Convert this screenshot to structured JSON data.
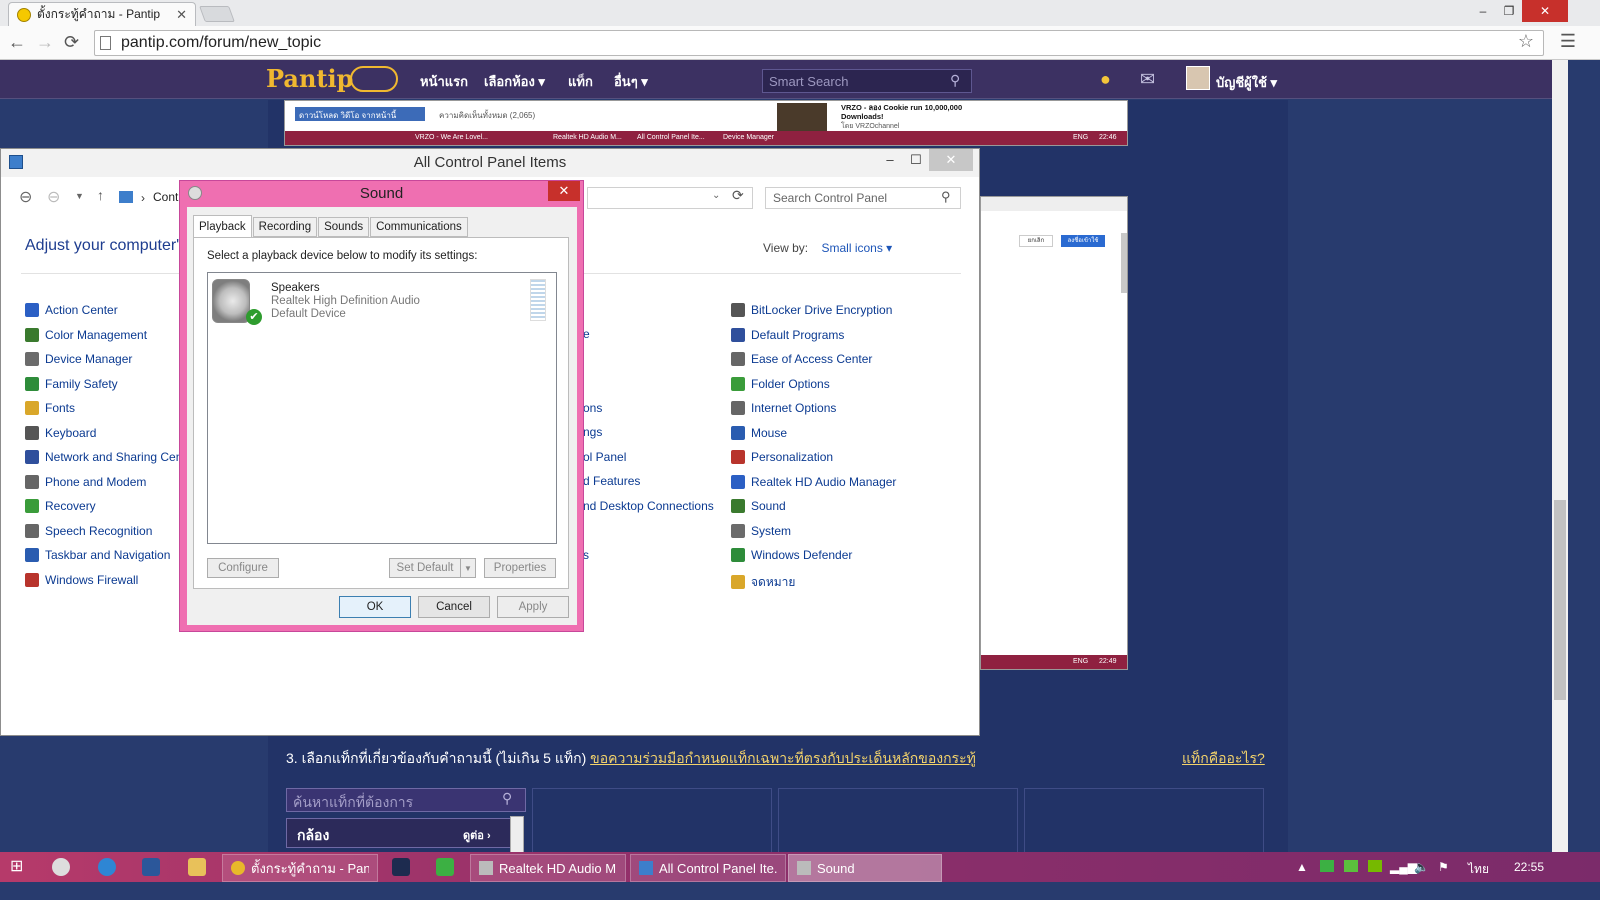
{
  "browser": {
    "tab_title": "ตั้งกระทู้คำถาม - Pantip",
    "url": "pantip.com/forum/new_topic"
  },
  "pantip": {
    "logo": "Pantip",
    "nav": [
      "หน้าแรก",
      "เลือกห้อง ▾",
      "แท็ก",
      "อื่นๆ ▾"
    ],
    "search_placeholder": "Smart Search",
    "user_label": "บัญชีผู้ใช้ ▾",
    "section3_text": "3. เลือกแท็กที่เกี่ยวข้องกับคำถามนี้ (ไม่เกิน 5 แท็ก)",
    "section3_link": "ขอความร่วมมือกำหนดแท็กเฉพาะที่ตรงกับประเด็นหลักของกระทู้",
    "tag_help": "แท็กคืออะไร?",
    "tag_search_placeholder": "ค้นหาแท็กที่ต้องการ",
    "tag_row_label": "กล้อง",
    "tag_row_more": "ดูต่อ ›"
  },
  "control_panel": {
    "title": "All Control Panel Items",
    "breadcrumb": "Cont",
    "search_placeholder": "Search Control Panel",
    "heading": "Adjust your computer's",
    "view_by_label": "View by:",
    "view_by_value": "Small icons ▾",
    "left_items": [
      "Action Center",
      "Color Management",
      "Device Manager",
      "Family Safety",
      "Fonts",
      "Keyboard",
      "Network and Sharing Cent",
      "Phone and Modem",
      "Recovery",
      "Speech Recognition",
      "Taskbar and Navigation",
      "Windows Firewall"
    ],
    "middle_fragments": [
      "e",
      "ons",
      "ngs",
      "ol Panel",
      "d Features",
      "nd Desktop Connections",
      "s"
    ],
    "right_items": [
      "BitLocker Drive Encryption",
      "Default Programs",
      "Ease of Access Center",
      "Folder Options",
      "Internet Options",
      "Mouse",
      "Personalization",
      "Realtek HD Audio Manager",
      "Sound",
      "System",
      "Windows Defender",
      "จดหมาย"
    ],
    "icon_colors": [
      "#2b5fc4",
      "#3a7a2e",
      "#6b6b6b",
      "#2e8c3a",
      "#d9a72a",
      "#555",
      "#2f4f9c",
      "#666",
      "#3a9c3a",
      "#666",
      "#2a5cb0",
      "#b8342c"
    ]
  },
  "sound_dialog": {
    "title": "Sound",
    "tabs": [
      "Playback",
      "Recording",
      "Sounds",
      "Communications"
    ],
    "hint": "Select a playback device below to modify its settings:",
    "device_name": "Speakers",
    "device_driver": "Realtek High Definition Audio",
    "device_status": "Default Device",
    "configure": "Configure",
    "set_default": "Set Default",
    "properties": "Properties",
    "ok": "OK",
    "cancel": "Cancel",
    "apply": "Apply"
  },
  "taskbar": {
    "apps": [
      "ตั้งกระทู้คำถาม - Pantip...",
      "Realtek HD Audio M...",
      "All Control Panel Ite...",
      "Sound"
    ],
    "lang": "ไทย",
    "time": "22:55"
  },
  "embedded": {
    "top_text1": "ดาวน์โหลด วิดีโอ จากหน้านี้",
    "top_text2": "ความคิดเห็นทั้งหมด (2,065)",
    "top_ad": "VRZO - ลอง Cookie run 10,000,000 Downloads!",
    "top_ad_sub": "โดย VRZOchannel",
    "top_taskbar_items": [
      "VRZO - We Are Lovel...",
      "Realtek HD Audio M...",
      "All Control Panel Ite...",
      "Device Manager"
    ],
    "top_taskbar_lang": "ENG",
    "top_taskbar_time": "22:46",
    "right_btn1": "ยกเลิก",
    "right_btn2": "ลงชื่อเข้าใช้",
    "right_taskbar_lang": "ENG",
    "right_taskbar_time": "22:49"
  }
}
